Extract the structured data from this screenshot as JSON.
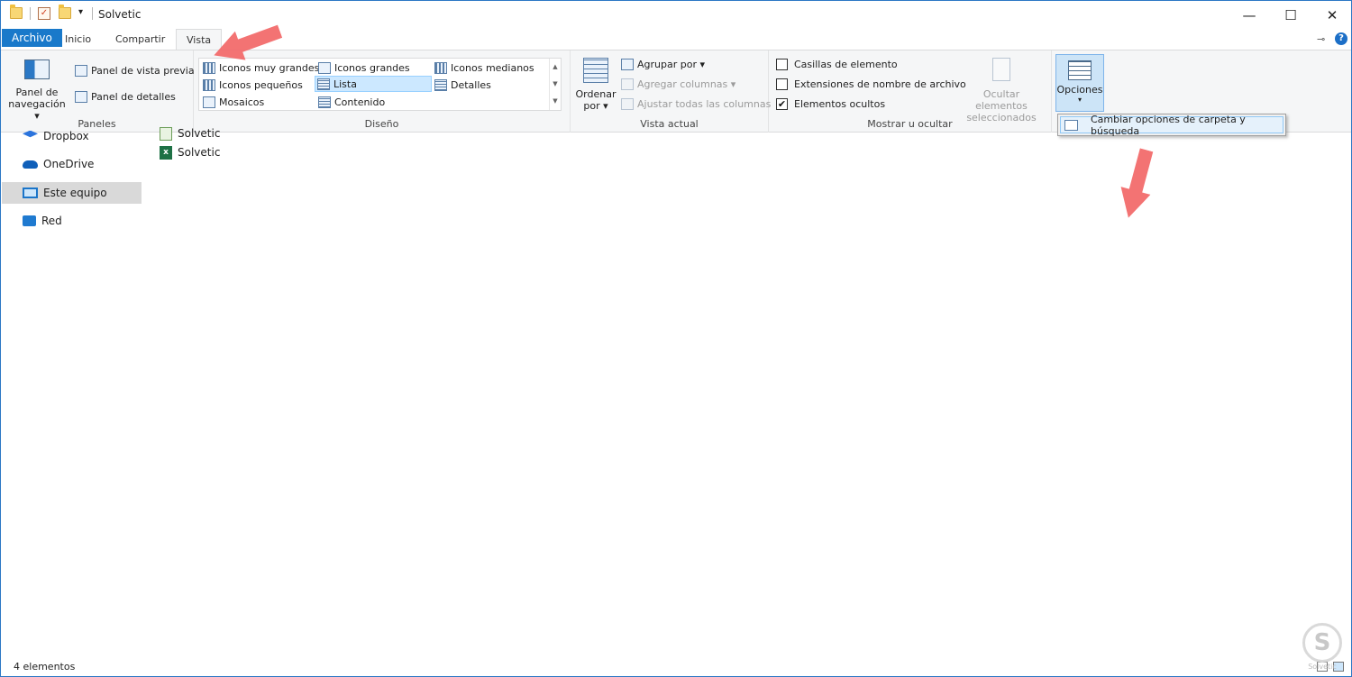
{
  "window": {
    "title": "Solvetic",
    "min_glyph": "—",
    "max_glyph": "☐",
    "close_glyph": "✕",
    "qa_dropdown_glyph": "▾"
  },
  "tabs": {
    "archivo": "Archivo",
    "inicio": "Inicio",
    "compartir": "Compartir",
    "vista": "Vista",
    "pin_glyph": "⊸",
    "help_glyph": "?"
  },
  "ribbon": {
    "paneles": {
      "label": "Paneles",
      "nav_pane_line1": "Panel de",
      "nav_pane_line2": "navegación ▾",
      "preview_pane": "Panel de vista previa",
      "details_pane": "Panel de detalles"
    },
    "diseno": {
      "label": "Diseño",
      "items": [
        "Iconos muy grandes",
        "Iconos grandes",
        "Iconos medianos",
        "Iconos pequeños",
        "Lista",
        "Detalles",
        "Mosaicos",
        "Contenido"
      ],
      "selected": "Lista"
    },
    "vista_actual": {
      "label": "Vista actual",
      "sort_line1": "Ordenar",
      "sort_line2": "por ▾",
      "group_by": "Agrupar por ▾",
      "add_columns": "Agregar columnas ▾",
      "fit_columns": "Ajustar todas las columnas"
    },
    "mostrar": {
      "label": "Mostrar u ocultar",
      "item_checkboxes": "Casillas de elemento",
      "item_checkboxes_checked": false,
      "extensions": "Extensiones de nombre de archivo",
      "extensions_checked": false,
      "hidden_items": "Elementos ocultos",
      "hidden_items_checked": true,
      "hide_selected_line1": "Ocultar elementos",
      "hide_selected_line2": "seleccionados"
    },
    "opciones": {
      "label": "Opciones",
      "arrow": "▾",
      "menu_item": "Cambiar opciones de carpeta y búsqueda"
    }
  },
  "nav": {
    "items": [
      "Dropbox",
      "OneDrive",
      "Este equipo",
      "Red"
    ],
    "selected": "Este equipo"
  },
  "files": [
    "Solvetic",
    "Solvetic"
  ],
  "status": {
    "count": "4 elementos"
  },
  "watermark": {
    "letter": "S",
    "text": "Solvetic"
  },
  "colors": {
    "file_tab": "#1979ca",
    "selection": "#cce8ff",
    "arrow": "#f26b6b"
  }
}
